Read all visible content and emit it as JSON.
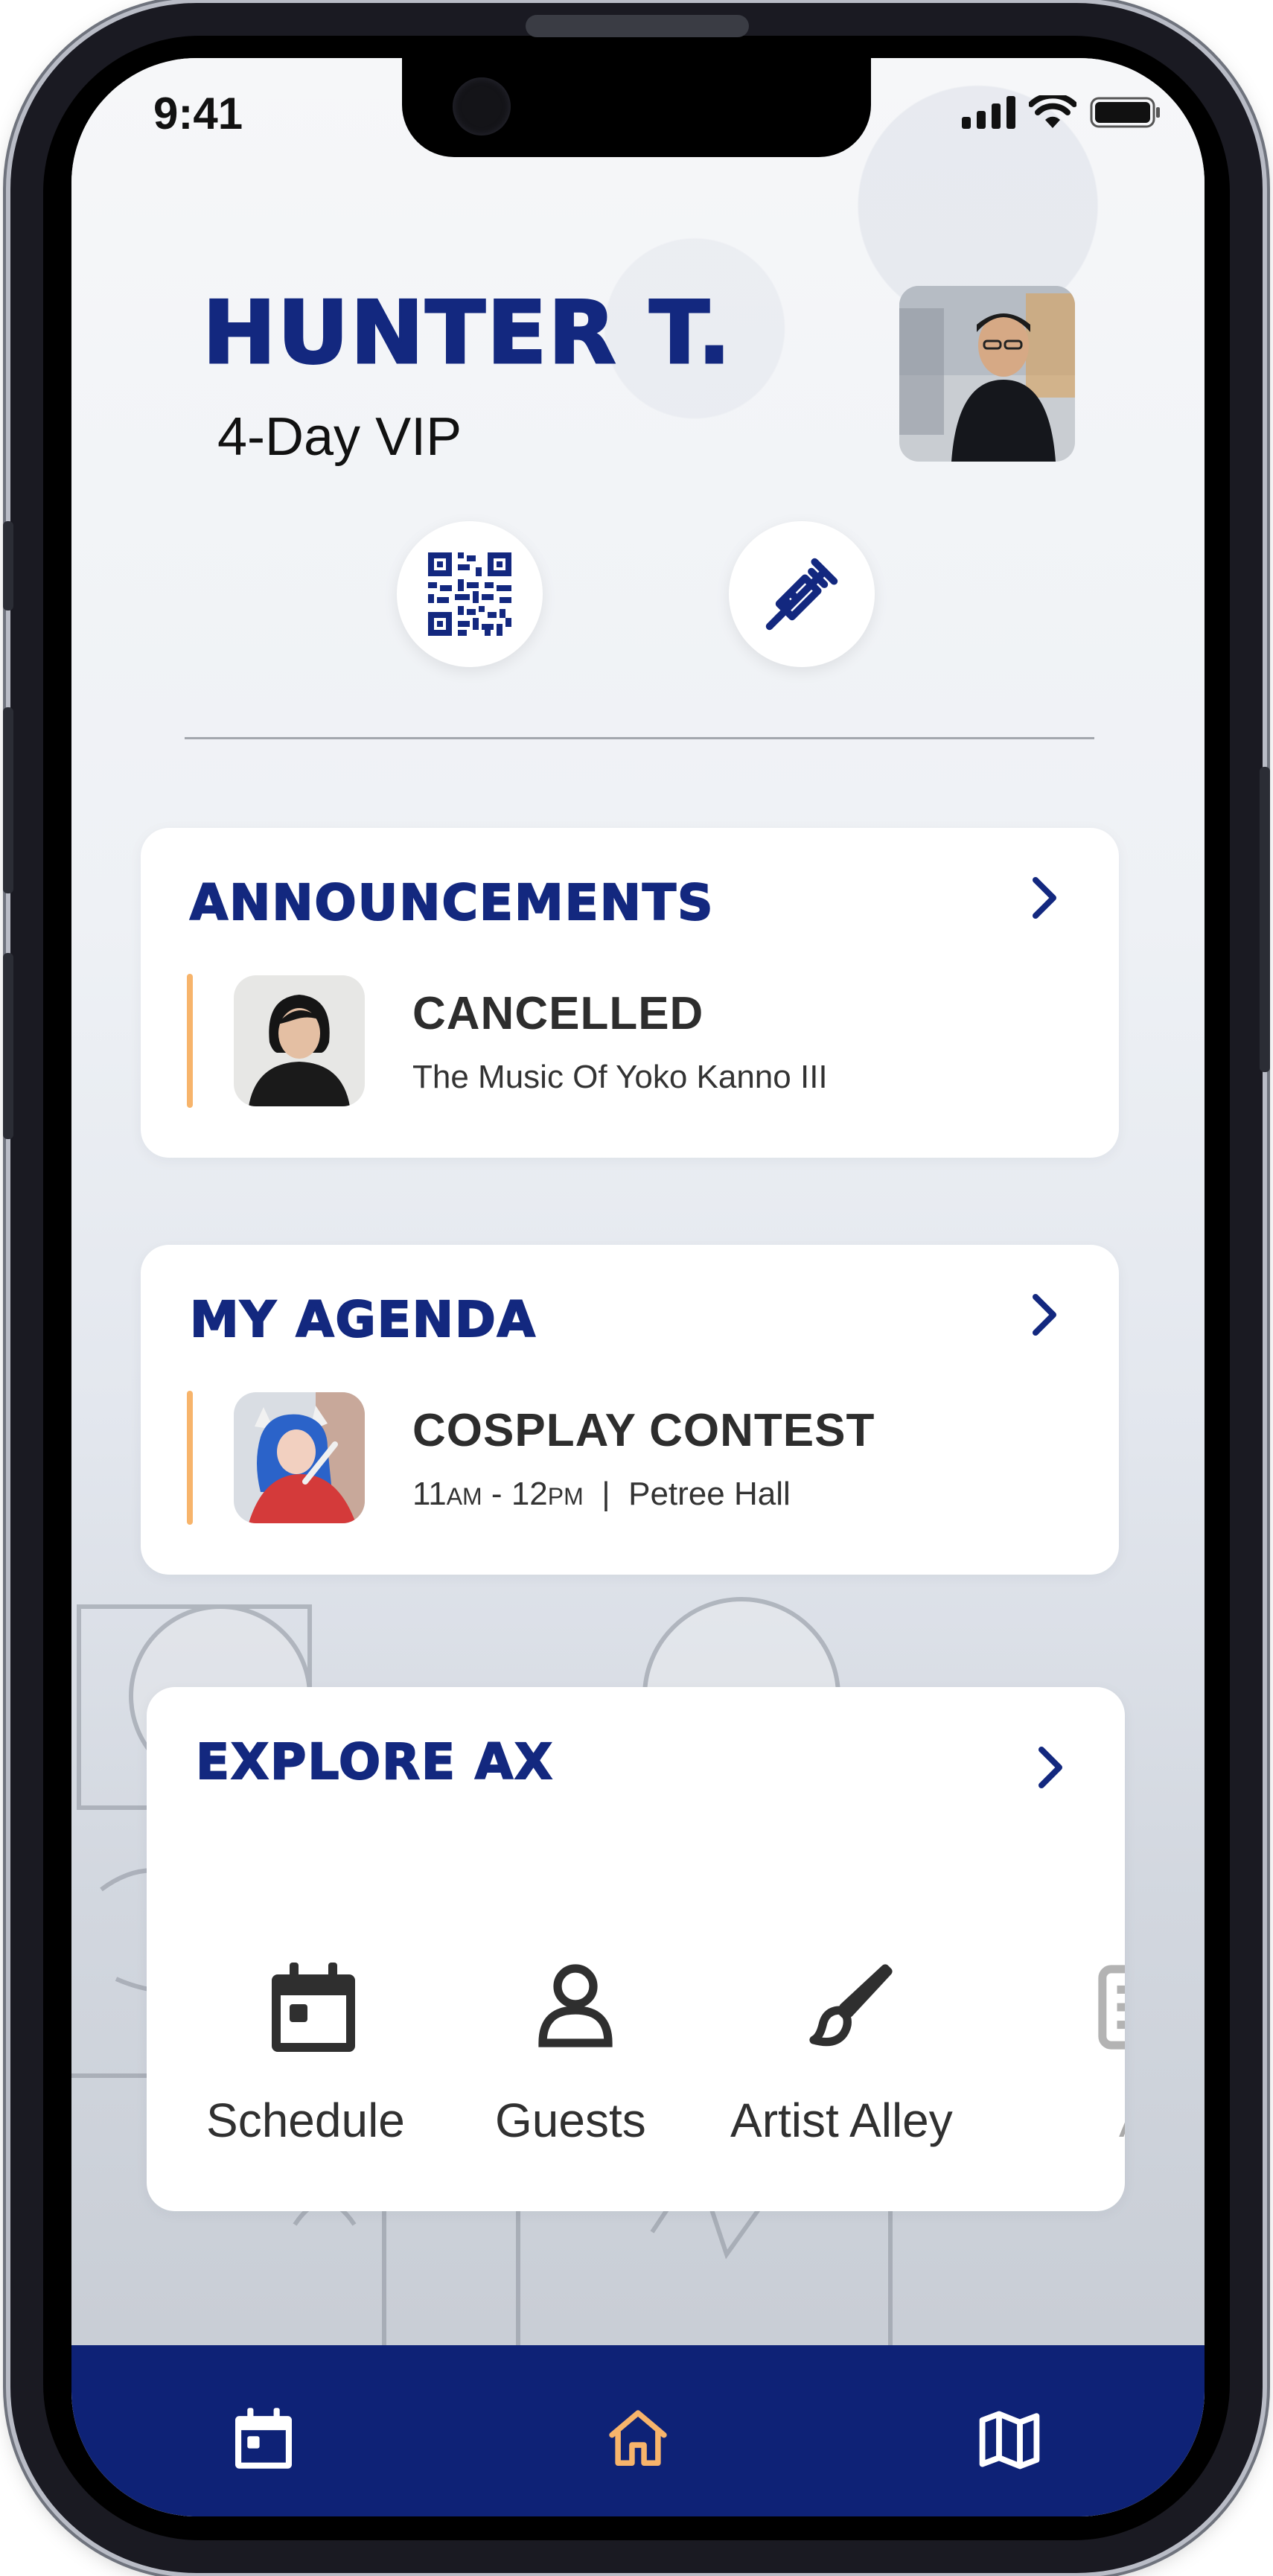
{
  "status_bar": {
    "time": "9:41"
  },
  "profile": {
    "name": "HUNTER T.",
    "ticket": "4-Day VIP",
    "avatar_icon": "user-photo",
    "qr_icon": "qr-code-icon",
    "vaccine_icon": "syringe-icon"
  },
  "announcements": {
    "title": "ANNOUNCEMENTS",
    "item": {
      "status": "CANCELLED",
      "event": "The Music Of Yoko Kanno III"
    }
  },
  "agenda": {
    "title": "MY AGENDA",
    "item": {
      "event": "COSPLAY CONTEST",
      "start_hour": "11",
      "start_ampm": "AM",
      "dash": "-",
      "end_hour": "12",
      "end_ampm": "PM",
      "separator": "|",
      "location": "Petree Hall"
    }
  },
  "explore": {
    "title": "EXPLORE AX",
    "items": [
      {
        "label": "Schedule",
        "icon": "calendar-icon"
      },
      {
        "label": "Guests",
        "icon": "person-icon"
      },
      {
        "label": "Artist Alley",
        "icon": "brush-icon"
      },
      {
        "label": "AX I",
        "icon": "document-icon"
      }
    ]
  },
  "bottom_nav": {
    "items": [
      {
        "icon": "calendar-icon",
        "active": false
      },
      {
        "icon": "home-icon",
        "active": true
      },
      {
        "icon": "map-icon",
        "active": false
      }
    ]
  },
  "colors": {
    "brand_navy": "#13287f",
    "nav_bg": "#0e2276",
    "accent_orange": "#f7b46b",
    "text_dark": "#2d2d2d"
  }
}
